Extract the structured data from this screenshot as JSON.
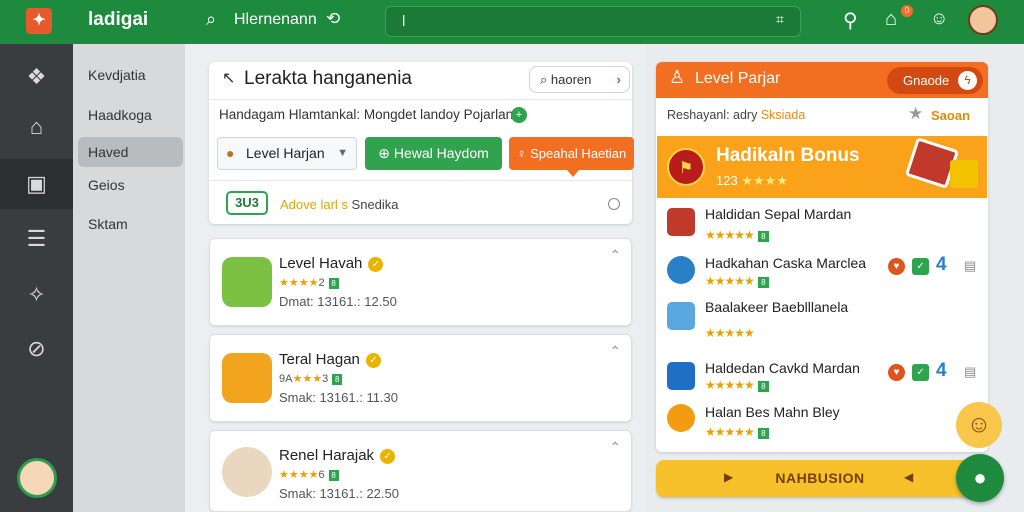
{
  "colors": {
    "topbar": "#1e8a3e",
    "accent_orange": "#f26f22",
    "accent_green": "#31a34f",
    "star_gold": "#e8a200",
    "cta_yellow": "#f6c12a"
  },
  "topbar": {
    "logo_icon": "logo-icon",
    "title": "ladigai",
    "search_label": "Hlernenann",
    "search_input_value": "l",
    "icons": [
      "search-icon",
      "history-icon",
      "scan-icon",
      "search-icon",
      "home-icon",
      "smiley-icon",
      "avatar"
    ],
    "notification_count": "0"
  },
  "rail": {
    "items": [
      "cube-icon",
      "home-icon",
      "inbox-icon",
      "list-icon",
      "share-icon",
      "compass-icon"
    ]
  },
  "nav2": {
    "items": [
      {
        "label": "Kevdjatia"
      },
      {
        "label": "Haadkoga"
      },
      {
        "label": "Haved"
      },
      {
        "label": "Geios"
      },
      {
        "label": "Sktam"
      }
    ],
    "active_index": 2
  },
  "main": {
    "title": "Lerakta hanganenia",
    "search_button": "haoren",
    "subtitle": "Handagam Hlamtankal: Mongdet landoy Pojarlan:",
    "select_value": "Level Harjan",
    "btn_green": "Hewal Haydom",
    "btn_orange": "Speahal Haetian",
    "status_badge": "3U3",
    "status_highlight": "Adove larl s",
    "status_text": "Snedika",
    "cards": [
      {
        "name": "Level Havah",
        "rating": "2",
        "meta": "Dmat: 13161.:  12.50"
      },
      {
        "name": "Teral Hagan",
        "rating": "3",
        "meta": "Smak: 13161.:  11.30"
      },
      {
        "name": "Renel Harajak",
        "rating": "6",
        "meta": "Smak: 13161.:  22.50"
      }
    ]
  },
  "right": {
    "header_title": "Level Parjar",
    "header_button": "Gnaode",
    "subline_a": "Reshayanl: adry",
    "subline_highlight": "Sksiada",
    "subline_right": "Saoan",
    "bonus_title": "Hadikaln Bonus",
    "bonus_sub": "123",
    "bonus_stars": "★★★★",
    "items": [
      {
        "name": "Haldidan Sepal Mardan",
        "stars": "★★★★★"
      },
      {
        "name": "Hadkahan Caska Marclea",
        "stars": "★★★★★",
        "badge": "4"
      },
      {
        "name": "Baalakeer Baeblllanela",
        "stars": "★★★★★"
      },
      {
        "name": "Haldedan Cavkd Mardan",
        "stars": "★★★★★",
        "badge": "4"
      },
      {
        "name": "Halan Bes Mahn Bley",
        "stars": "★★★★★"
      }
    ],
    "cta_label": "NAHBUSION"
  }
}
